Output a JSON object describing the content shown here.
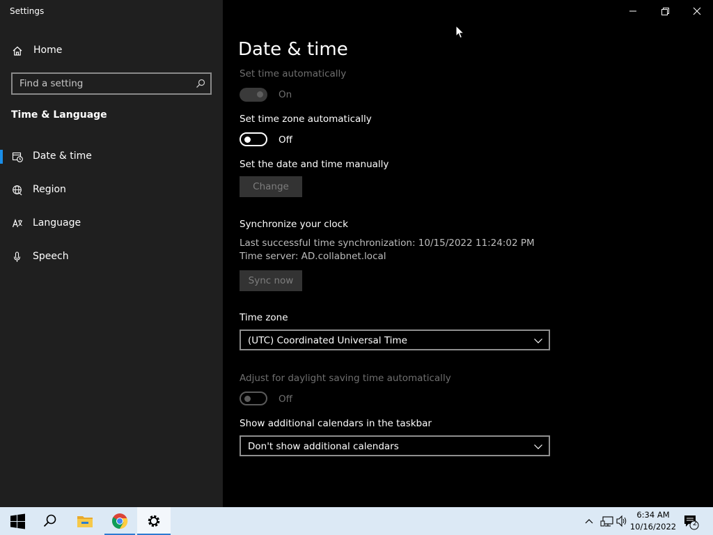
{
  "window": {
    "title": "Settings",
    "controls": {
      "minimize": "minimize",
      "restore": "restore",
      "close": "close"
    }
  },
  "sidebar": {
    "home_label": "Home",
    "search_placeholder": "Find a setting",
    "section_title": "Time & Language",
    "items": [
      {
        "label": "Date & time",
        "icon": "date-time-icon",
        "active": true
      },
      {
        "label": "Region",
        "icon": "globe-icon",
        "active": false
      },
      {
        "label": "Language",
        "icon": "language-icon",
        "active": false
      },
      {
        "label": "Speech",
        "icon": "microphone-icon",
        "active": false
      }
    ]
  },
  "main": {
    "page_title": "Date & time",
    "set_time_auto": {
      "label": "Set time automatically",
      "state": "On",
      "enabled": false,
      "on": true
    },
    "set_tz_auto": {
      "label": "Set time zone automatically",
      "state": "Off",
      "enabled": true,
      "on": false
    },
    "manual": {
      "label": "Set the date and time manually",
      "button": "Change"
    },
    "sync": {
      "heading": "Synchronize your clock",
      "last_sync": "Last successful time synchronization: 10/15/2022 11:24:02 PM",
      "server": "Time server: AD.collabnet.local",
      "button": "Sync now"
    },
    "timezone": {
      "label": "Time zone",
      "value": "(UTC) Coordinated Universal Time"
    },
    "dst": {
      "label": "Adjust for daylight saving time automatically",
      "state": "Off",
      "enabled": false,
      "on": false
    },
    "calendars": {
      "label": "Show additional calendars in the taskbar",
      "value": "Don't show additional calendars"
    }
  },
  "taskbar": {
    "time": "6:34 AM",
    "date": "10/16/2022",
    "notification_count": "2",
    "apps": [
      "start-icon",
      "search-icon",
      "file-explorer-icon",
      "chrome-icon",
      "settings-gear-icon"
    ]
  },
  "colors": {
    "accent": "#1a8ee8",
    "sidebar_bg": "#1f1f1f",
    "main_bg": "#000000",
    "taskbar_bg": "#dce9f5"
  }
}
